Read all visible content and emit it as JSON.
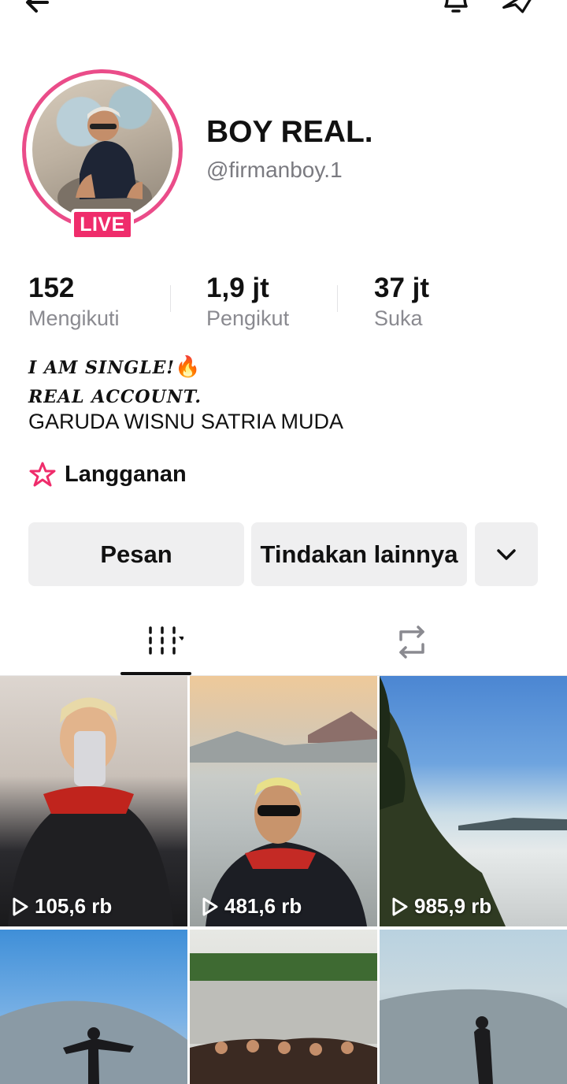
{
  "header": {
    "back_icon": "arrow-left-icon",
    "bell_icon": "bell-icon",
    "share_icon": "share-arrow-icon"
  },
  "profile": {
    "live_badge": "LIVE",
    "display_name": "BOY REAL.",
    "username": "@firmanboy.1"
  },
  "stats": [
    {
      "value": "152",
      "label": "Mengikuti"
    },
    {
      "value": "1,9 jt",
      "label": "Pengikut"
    },
    {
      "value": "37 jt",
      "label": "Suka"
    }
  ],
  "bio": {
    "line1": "I AM SINGLE!",
    "line1_emoji": "🔥",
    "line2": "REAL ACCOUNT.",
    "line3": "GARUDA WISNU SATRIA MUDA"
  },
  "subscription": {
    "label": "Langganan",
    "icon": "star-badge-icon"
  },
  "actions": {
    "message": "Pesan",
    "more_actions": "Tindakan lainnya",
    "dropdown_icon": "chevron-down-icon"
  },
  "tabs": [
    {
      "name": "videos",
      "icon": "grid-icon",
      "active": true
    },
    {
      "name": "reposts",
      "icon": "repost-icon",
      "active": false
    }
  ],
  "videos": [
    {
      "views": "105,6 rb"
    },
    {
      "views": "481,6 rb"
    },
    {
      "views": "985,9 rb"
    },
    {
      "views": ""
    },
    {
      "views": ""
    },
    {
      "views": ""
    }
  ],
  "colors": {
    "live_pink": "#ef2c6b",
    "ring_pink": "#ea4c89",
    "button_gray": "#efeff0",
    "star_red": "#ef2c6b"
  }
}
